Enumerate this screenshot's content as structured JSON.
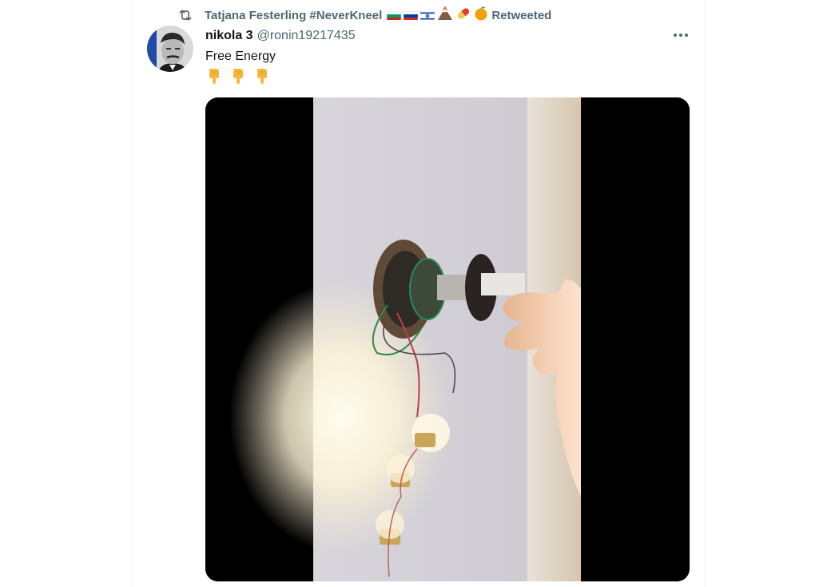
{
  "retweet_banner": {
    "retweeter_name": "Tatjana Festerling #NeverKneel",
    "suffix": "Retweeted",
    "icon": "retweet-icon",
    "emojis": [
      "bulgaria-flag",
      "russia-flag",
      "israel-flag",
      "volcano",
      "pill",
      "orange"
    ]
  },
  "tweet": {
    "display_name": "nikola 3",
    "handle": "@ronin19217435",
    "text": "Free Energy",
    "emoji_line": [
      "pointing-down",
      "pointing-down",
      "pointing-down"
    ],
    "more_icon": "more-horizontal-icon",
    "media": {
      "type": "video",
      "description_icons": [
        "speaker",
        "magnet",
        "light-bulbs",
        "hand"
      ]
    }
  },
  "colors": {
    "secondary_text": "#536471",
    "primary_text": "#0f1419",
    "border": "#eff3f4"
  }
}
